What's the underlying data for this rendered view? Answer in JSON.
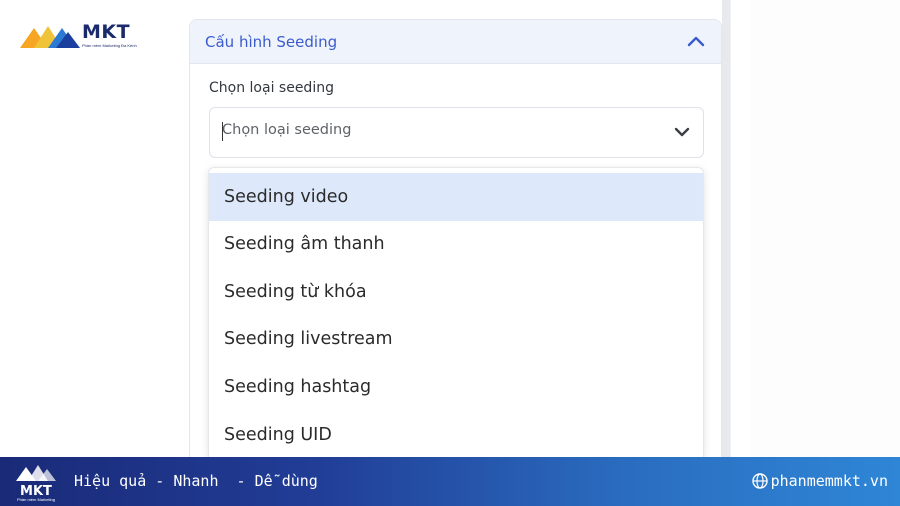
{
  "logo": {
    "brand": "MKT",
    "subtitle": "Phần mềm Marketing Đa Kênh"
  },
  "card": {
    "title": "Cấu hình Seeding",
    "field_label": "Chọn loại seeding",
    "select_placeholder": "Chọn loại seeding"
  },
  "dropdown": {
    "options": [
      {
        "label": "Seeding video",
        "active": true
      },
      {
        "label": "Seeding âm thanh",
        "active": false
      },
      {
        "label": "Seeding từ khóa",
        "active": false
      },
      {
        "label": "Seeding livestream",
        "active": false
      },
      {
        "label": "Seeding hashtag",
        "active": false
      },
      {
        "label": "Seeding UID",
        "active": false
      }
    ]
  },
  "banner": {
    "brand": "MKT",
    "brand_sub": "Phần mềm Marketing",
    "tagline": "Hiệu quả - Nhanh  - Dễ dùng",
    "website": "phanmemmkt.vn"
  },
  "colors": {
    "accent": "#3b5bcc",
    "active_option": "#dde8fb",
    "header_bg": "#eff3fc",
    "banner_start": "#1a2a78",
    "banner_end": "#2f86d6"
  }
}
